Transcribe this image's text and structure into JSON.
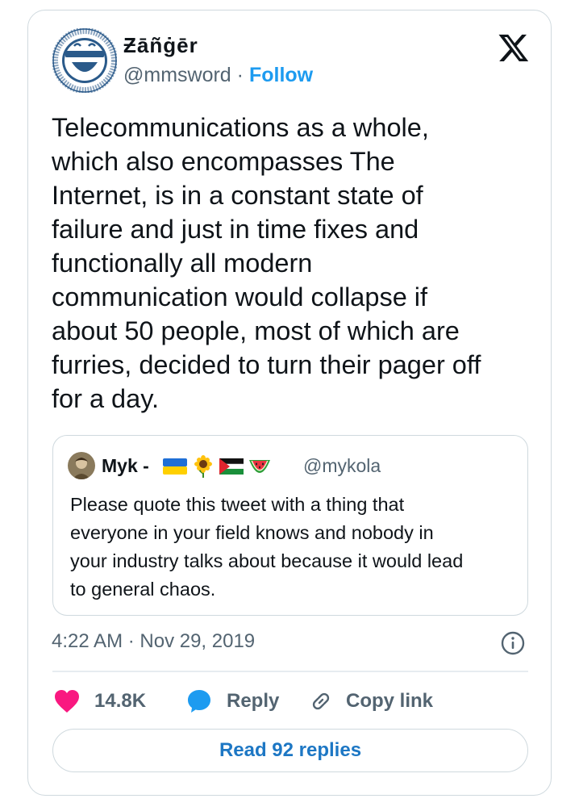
{
  "author": {
    "display_name": "Ƶāñġēr",
    "handle": "@mmsword",
    "separator": "·",
    "follow_label": "Follow"
  },
  "tweet": {
    "lines": [
      "Telecommunications as a whole,",
      "which also encompasses The",
      "Internet, is in a constant state of",
      "failure and just in time fixes and",
      "functionally all modern",
      "communication would collapse if",
      "about 50 people, most of which are",
      "furries, decided to turn their pager off",
      "for a day."
    ],
    "timestamp": "4:22 AM · Nov 29, 2019"
  },
  "quote": {
    "display_name": "Myk -",
    "flags": [
      "ukraine-flag-icon",
      "sunflower-icon",
      "palestine-flag-icon",
      "watermelon-icon"
    ],
    "handle": "@mykola",
    "lines": [
      "Please quote this tweet with a thing that",
      "everyone in your field knows and nobody in",
      "your industry talks about because it would lead",
      "to general chaos."
    ]
  },
  "actions": {
    "likes": "14.8K",
    "reply_label": "Reply",
    "copy_label": "Copy link",
    "read_replies_label": "Read 92 replies"
  },
  "colors": {
    "accent": "#1d9bf0",
    "like": "#f91880",
    "muted": "#536471",
    "text": "#0f1419",
    "border": "#cfd9de"
  }
}
